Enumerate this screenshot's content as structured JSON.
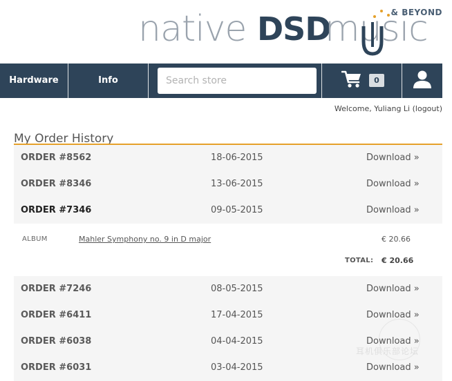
{
  "logo": {
    "native": "native",
    "dsd": "DSD",
    "music": "music",
    "beyond": "& BEYOND"
  },
  "nav": {
    "hardware_label": "Hardware",
    "info_label": "Info",
    "search_placeholder": "Search store",
    "cart_count": "0"
  },
  "welcome": {
    "text": "Welcome, Yuliang Li",
    "logout": "(logout)"
  },
  "page": {
    "title": "My Order History"
  },
  "orders": [
    {
      "number": "ORDER #8562",
      "date": "18-06-2015",
      "action": "Download »"
    },
    {
      "number": "ORDER #8346",
      "date": "13-06-2015",
      "action": "Download »"
    },
    {
      "number": "ORDER #7346",
      "date": "09-05-2015",
      "action": "Download »"
    },
    {
      "number": "ORDER #7246",
      "date": "08-05-2015",
      "action": "Download »"
    },
    {
      "number": "ORDER #6411",
      "date": "17-04-2015",
      "action": "Download »"
    },
    {
      "number": "ORDER #6038",
      "date": "04-04-2015",
      "action": "Download »"
    },
    {
      "number": "ORDER #6031",
      "date": "03-04-2015",
      "action": "Download »"
    }
  ],
  "expanded_order": {
    "item_type": "ALBUM",
    "item_title": "Mahler Symphony no. 9 in D major",
    "item_price": "€ 20.66",
    "total_label": "TOTAL:",
    "total": "€ 20.66"
  },
  "watermark": {
    "text": "耳机俱乐部论坛"
  },
  "colors": {
    "navbar": "#2e4459",
    "accent": "#e5a02a",
    "row_bg": "#f5f5f5"
  }
}
